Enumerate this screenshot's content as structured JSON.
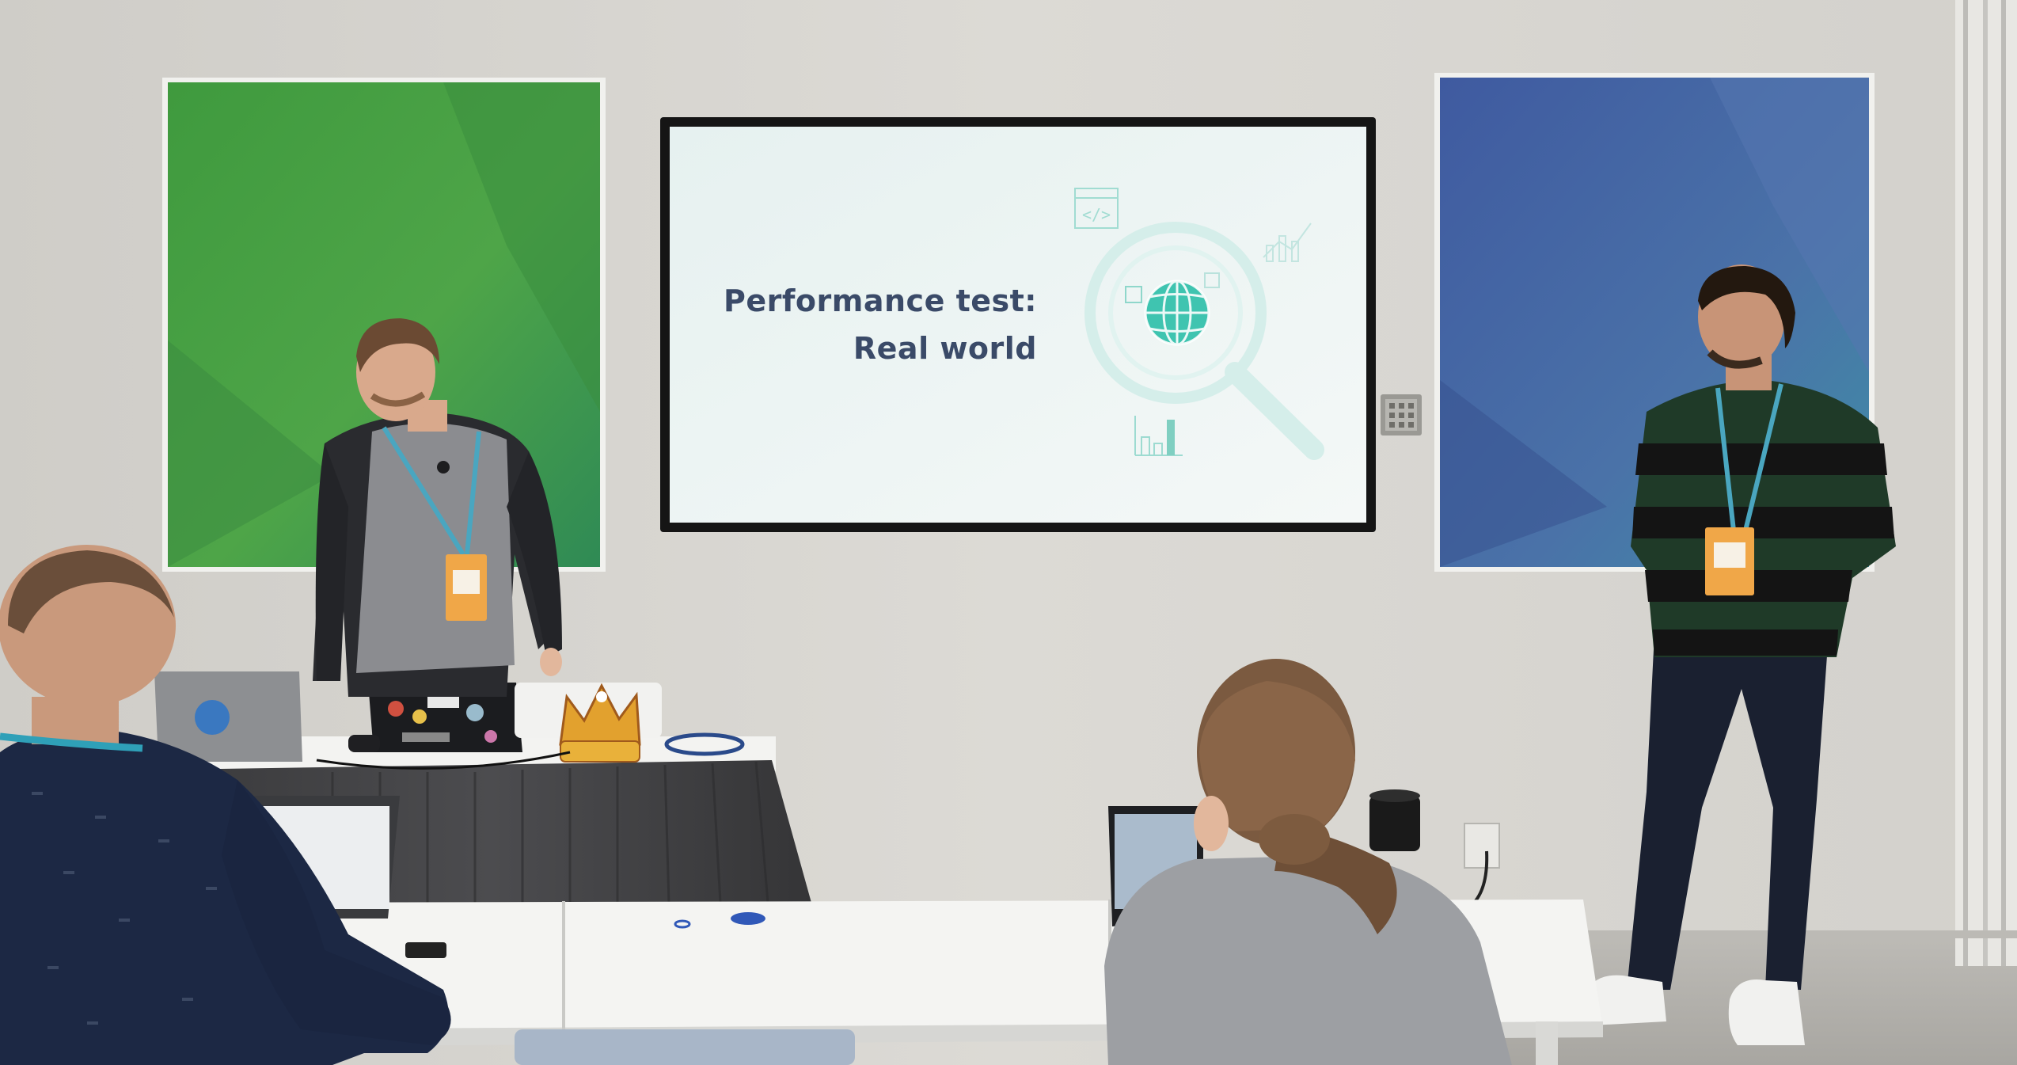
{
  "slide": {
    "title_line1": "Performance test:",
    "title_line2": "Real world"
  },
  "colors": {
    "wall": "#d8d6d1",
    "left_panel": "#4a9a45",
    "right_panel": "#4a68a0",
    "slide_bg": "#eef5f4",
    "slide_text": "#3a4a68",
    "accent_teal": "#3fc4b0"
  },
  "icons": [
    "globe-icon",
    "magnifier-icon",
    "code-icon",
    "chart-icon"
  ]
}
